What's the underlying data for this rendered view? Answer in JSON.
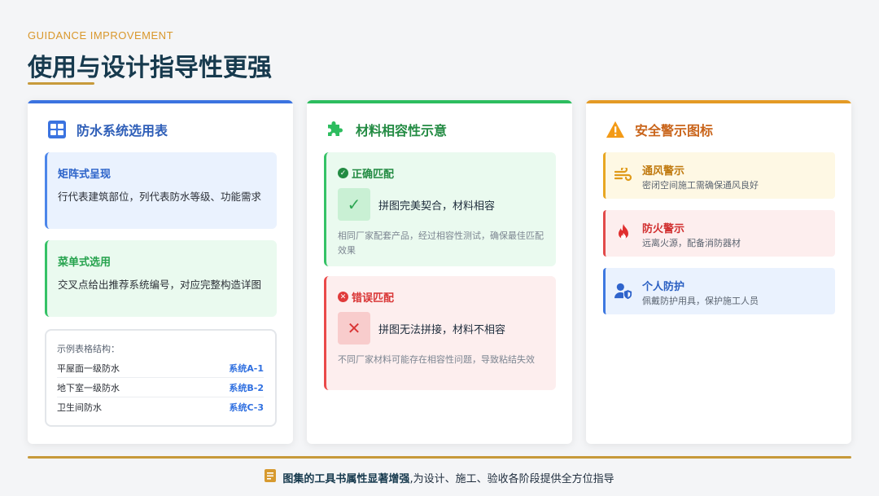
{
  "header": {
    "eyebrow": "GUIDANCE IMPROVEMENT",
    "title": "使用与设计指导性更强"
  },
  "colors": {
    "blue": "#3b73e0",
    "green": "#2dbd5f",
    "orange": "#e49a25",
    "gold": "#c79a3b",
    "red": "#e24a4a"
  },
  "cards": {
    "system": {
      "icon": "grid-table-icon",
      "title": "防水系统选用表",
      "matrix": {
        "title": "矩阵式呈现",
        "desc": "行代表建筑部位，列代表防水等级、功能需求"
      },
      "menu": {
        "title": "菜单式选用",
        "desc": "交叉点给出推荐系统编号，对应完整构造详图"
      },
      "example": {
        "title": "示例表格结构：",
        "rows": [
          {
            "name": "平屋面一级防水",
            "code": "系统A-1"
          },
          {
            "name": "地下室一级防水",
            "code": "系统B-2"
          },
          {
            "name": "卫生间防水",
            "code": "系统C-3"
          }
        ]
      }
    },
    "compat": {
      "icon": "puzzle-icon",
      "title": "材料相容性示意",
      "ok": {
        "title": "正确匹配",
        "label": "拼图完美契合，材料相容",
        "desc": "相同厂家配套产品，经过相容性测试，确保最佳匹配效果"
      },
      "bad": {
        "title": "错误匹配",
        "label": "拼图无法拼接，材料不相容",
        "desc": "不同厂家材料可能存在相容性问题，导致粘结失效"
      }
    },
    "safety": {
      "icon": "warning-triangle-icon",
      "title": "安全警示图标",
      "items": [
        {
          "icon": "wind-icon",
          "title": "通风警示",
          "desc": "密闭空间施工需确保通风良好"
        },
        {
          "icon": "fire-icon",
          "title": "防火警示",
          "desc": "远离火源，配备消防器材"
        },
        {
          "icon": "user-shield-icon",
          "title": "个人防护",
          "desc": "佩戴防护用具，保护施工人员"
        }
      ]
    }
  },
  "footer": {
    "icon": "book-icon",
    "strong": "图集的工具书属性显著增强",
    "rest": ",为设计、施工、验收各阶段提供全方位指导"
  }
}
